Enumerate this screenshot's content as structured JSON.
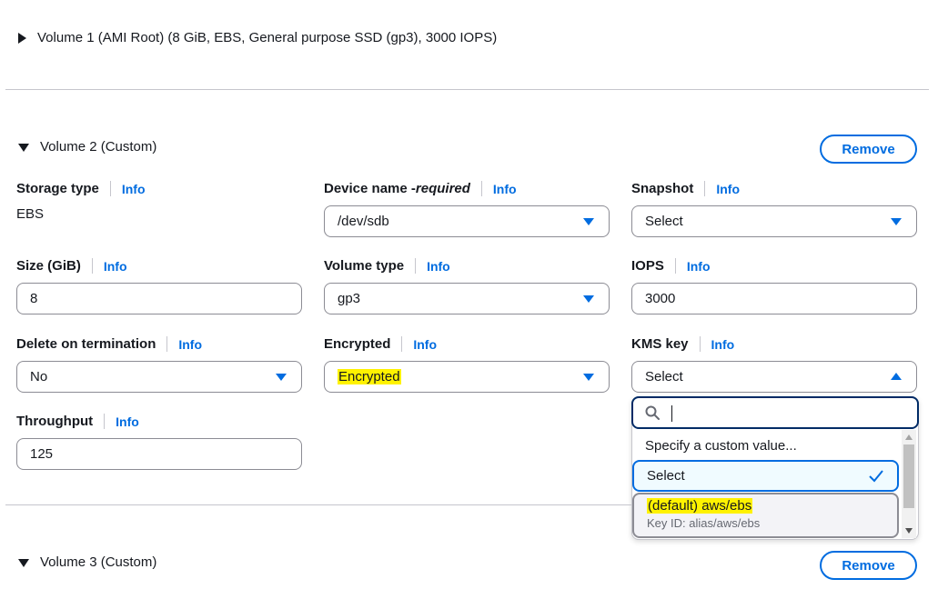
{
  "volume1": {
    "title": "Volume 1 (AMI Root) (8 GiB, EBS, General purpose SSD (gp3), 3000 IOPS)"
  },
  "volume2": {
    "title": "Volume 2 (Custom)",
    "remove_label": "Remove",
    "info_label": "Info",
    "storage_type": {
      "label": "Storage type",
      "value": "EBS"
    },
    "device_name": {
      "label": "Device name - ",
      "required": "required",
      "value": "/dev/sdb"
    },
    "snapshot": {
      "label": "Snapshot",
      "value": "Select"
    },
    "size": {
      "label": "Size (GiB)",
      "value": "8"
    },
    "volume_type": {
      "label": "Volume type",
      "value": "gp3"
    },
    "iops": {
      "label": "IOPS",
      "value": "3000"
    },
    "delete_on_termination": {
      "label": "Delete on termination",
      "value": "No"
    },
    "encrypted": {
      "label": "Encrypted",
      "value": "Encrypted"
    },
    "kms_key": {
      "label": "KMS key",
      "value": "Select",
      "search_placeholder": "",
      "options": [
        {
          "label": "Specify a custom value..."
        },
        {
          "label": "Select",
          "selected": true
        },
        {
          "label": "(default) aws/ebs",
          "subtext": "Key ID: alias/aws/ebs"
        }
      ]
    },
    "throughput": {
      "label": "Throughput",
      "value": "125"
    }
  },
  "volume3": {
    "title": "Volume 3 (Custom)",
    "remove_label": "Remove"
  },
  "colors": {
    "accent": "#006ce0",
    "highlight": "#fff200",
    "text": "#16191f",
    "border": "#8c8c94"
  },
  "icons": {
    "collapsed": "caret-right-icon",
    "expanded": "caret-down-icon",
    "dropdown": "triangle-down-icon",
    "search": "search-icon",
    "check": "check-icon"
  }
}
